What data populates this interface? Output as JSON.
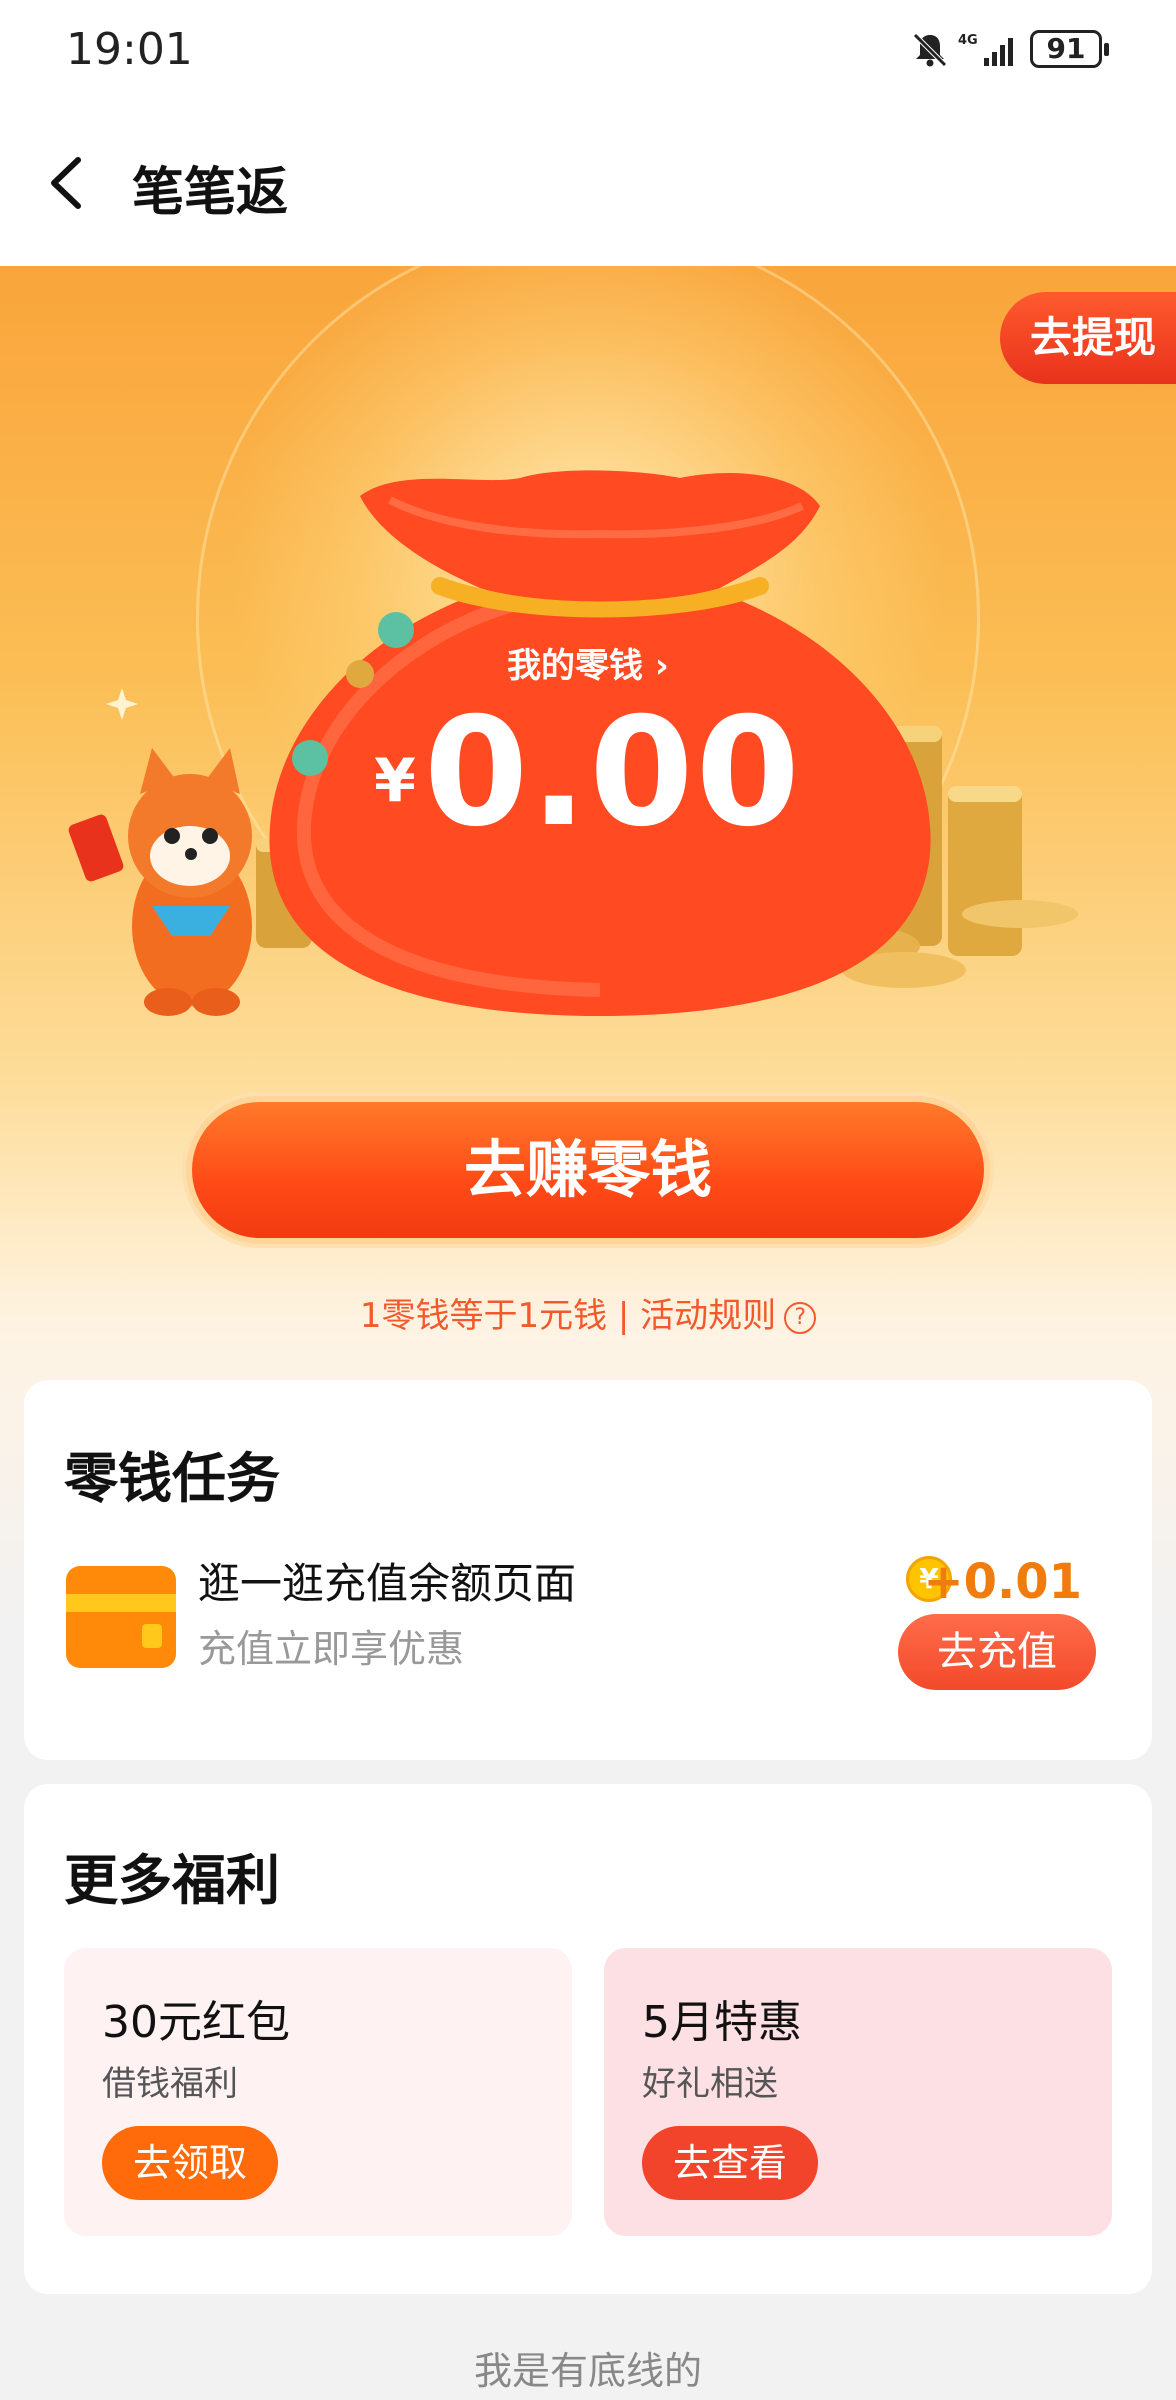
{
  "status_bar": {
    "time": "19:01",
    "network": "4G",
    "battery": "91"
  },
  "nav": {
    "title": "笔笔返"
  },
  "hero": {
    "withdraw_label": "去提现",
    "balance_label": "我的零钱",
    "currency_symbol": "¥",
    "balance": "0.00",
    "earn_button": "去赚零钱",
    "rule_text": "1零钱等于1元钱 | 活动规则",
    "rule_icon": "?"
  },
  "tasks": {
    "title": "零钱任务",
    "items": [
      {
        "icon": "card-icon",
        "name": "逛一逛充值余额页面",
        "subtitle": "充值立即享优惠",
        "reward": "+0.01",
        "coin_glyph": "¥",
        "button": "去充值"
      }
    ]
  },
  "benefits": {
    "title": "更多福利",
    "items": [
      {
        "title": "30元红包",
        "subtitle": "借钱福利",
        "button": "去领取",
        "bg": "#fff2f2",
        "button_color": "#ff6a0a"
      },
      {
        "title": "5月特惠",
        "subtitle": "好礼相送",
        "button": "去查看",
        "bg": "#fde0e4",
        "button_color": "#f2442a"
      }
    ]
  },
  "footer": {
    "text": "我是有底线的"
  }
}
